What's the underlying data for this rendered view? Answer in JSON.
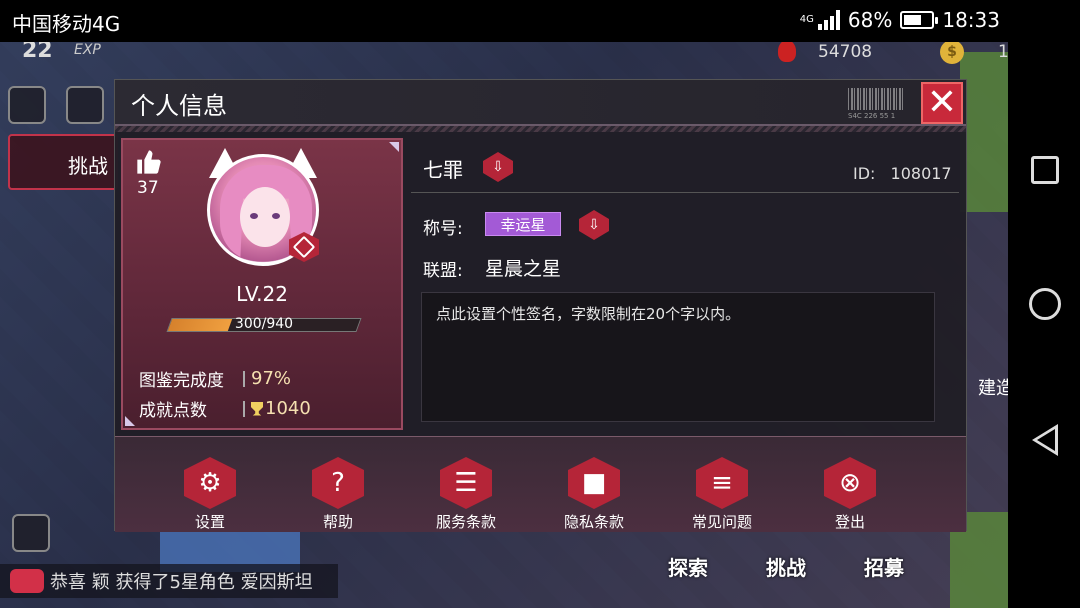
{
  "status_bar": {
    "carrier": "中国移动4G",
    "network": "4G",
    "battery": "68%",
    "battery_level": 0.68,
    "time": "18:33"
  },
  "game_hud": {
    "level": "22",
    "exp_label": "EXP",
    "gold": "54708",
    "coin_partial": "1",
    "challenge_label": "挑战",
    "ticker": "恭喜 颖 获得了5星角色 爱因斯坦",
    "bottom_buttons": [
      "探索",
      "挑战",
      "招募"
    ],
    "build_label": "建造"
  },
  "dialog": {
    "title": "个人信息",
    "barcode_text": "S4C 226 55 1",
    "close_label": "✕"
  },
  "profile": {
    "likes": "37",
    "level": "LV.22",
    "exp_text": "300/940",
    "exp_fraction": 0.319,
    "stats": [
      {
        "label": "图鉴完成度",
        "value": "97%"
      },
      {
        "label": "成就点数",
        "value": "1040"
      }
    ]
  },
  "info": {
    "name": "七罪",
    "uid_label": "ID:",
    "uid": "108017",
    "title_label": "称号:",
    "title_badge": "幸运星",
    "alliance_label": "联盟:",
    "alliance": "星晨之星",
    "signature": "点此设置个性签名，字数限制在20个字以内。"
  },
  "actions": [
    {
      "label": "设置",
      "icon": "gear-icon"
    },
    {
      "label": "帮助",
      "icon": "help-doc-icon"
    },
    {
      "label": "服务条款",
      "icon": "document-stack-icon"
    },
    {
      "label": "隐私条款",
      "icon": "lock-icon"
    },
    {
      "label": "常见问题",
      "icon": "sliders-icon"
    },
    {
      "label": "登出",
      "icon": "logout-x-icon"
    }
  ],
  "colors": {
    "accent_red": "#b52538",
    "card_pink": "#7a3447",
    "title_purple": "#a35ad6",
    "exp_orange": "#f0a040"
  }
}
